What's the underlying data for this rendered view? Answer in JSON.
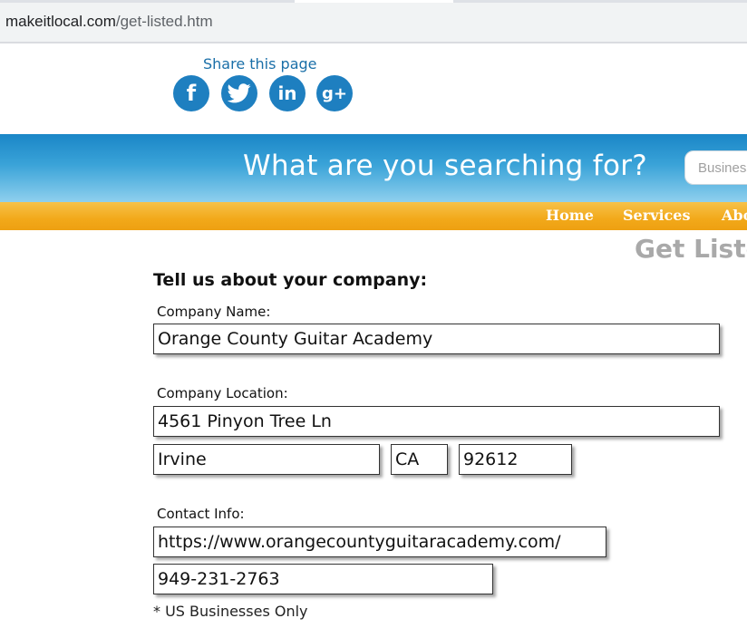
{
  "browser": {
    "url_domain": "makeitlocal.com",
    "url_path": "/get-listed.htm"
  },
  "share": {
    "label": "Share this page",
    "icons": [
      {
        "name": "facebook-icon",
        "glyph": "f"
      },
      {
        "name": "twitter-icon",
        "glyph": ""
      },
      {
        "name": "linkedin-icon",
        "glyph": "in"
      },
      {
        "name": "google-plus-icon",
        "glyph": "g+"
      }
    ],
    "color": "#1e7fc0"
  },
  "hero": {
    "title": "What are you searching for?",
    "search_placeholder": "Business"
  },
  "nav": {
    "items": [
      "Home",
      "Services",
      "About"
    ]
  },
  "page": {
    "heading": "Get Listed"
  },
  "form": {
    "title": "Tell us about your company:",
    "company_name_label": "Company Name:",
    "company_name_value": "Orange County Guitar Academy",
    "location_label": "Company Location:",
    "street_value": "4561 Pinyon Tree Ln",
    "city_value": "Irvine",
    "state_value": "CA",
    "zip_value": "92612",
    "contact_label": "Contact Info:",
    "website_value": "https://www.orangecountyguitaracademy.com/",
    "phone_value": "949-231-2763",
    "note": "* US Businesses Only"
  },
  "colors": {
    "hero_blue": "#1a86c7",
    "nav_orange": "#f2a91a",
    "heading_gray": "#a9a9a9",
    "link_blue": "#1a6fa8"
  }
}
